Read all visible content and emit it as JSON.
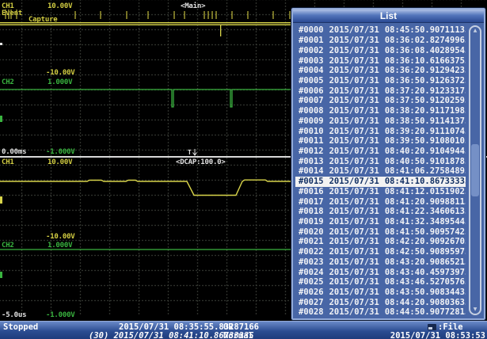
{
  "scope": {
    "overview": {
      "ch_label": "CH1",
      "ch_scale": "10.00V",
      "mode_label": "<Main>",
      "event_label": "Event",
      "capture_label": "Capture"
    },
    "upper_section": {
      "ch1_neg_scale": "-10.00V",
      "ch2_label": "CH2",
      "ch2_scale": "1.000V",
      "time_offset": "0.00ms",
      "ch2_neg_scale": "-1.000V"
    },
    "lower_section": {
      "ch1_label": "CH1",
      "ch1_scale": "10.00V",
      "dcap_label": "<DCAP:100.0>",
      "trigger_marker": "T",
      "ch1_neg_scale": "-10.00V",
      "ch2_label": "CH2",
      "ch2_scale": "1.000V",
      "time_offset": "-5.0us",
      "ch2_neg_scale": "-1.000V"
    },
    "colors": {
      "ch1_yellow": "#d2cd42",
      "ch2_green": "#39b33f",
      "white": "#e4e4e4"
    }
  },
  "list_dialog": {
    "title": "List",
    "selected_index": 15,
    "rows": [
      {
        "id": "#0000",
        "date": "2015/07/31",
        "time": "08:45:50.90711135"
      },
      {
        "id": "#0001",
        "date": "2015/07/31",
        "time": "08:36:02.82749965"
      },
      {
        "id": "#0002",
        "date": "2015/07/31",
        "time": "08:36:08.40289545"
      },
      {
        "id": "#0003",
        "date": "2015/07/31",
        "time": "08:36:10.61663755"
      },
      {
        "id": "#0004",
        "date": "2015/07/31",
        "time": "08:36:20.91294235"
      },
      {
        "id": "#0005",
        "date": "2015/07/31",
        "time": "08:36:50.91263725"
      },
      {
        "id": "#0006",
        "date": "2015/07/31",
        "time": "08:37:20.91233175"
      },
      {
        "id": "#0007",
        "date": "2015/07/31",
        "time": "08:37:50.91202595"
      },
      {
        "id": "#0008",
        "date": "2015/07/31",
        "time": "08:38:20.91171985"
      },
      {
        "id": "#0009",
        "date": "2015/07/31",
        "time": "08:38:50.91141375"
      },
      {
        "id": "#0010",
        "date": "2015/07/31",
        "time": "08:39:20.91110745"
      },
      {
        "id": "#0011",
        "date": "2015/07/31",
        "time": "08:39:50.91080105"
      },
      {
        "id": "#0012",
        "date": "2015/07/31",
        "time": "08:40:20.91049445"
      },
      {
        "id": "#0013",
        "date": "2015/07/31",
        "time": "08:40:50.91018785"
      },
      {
        "id": "#0014",
        "date": "2015/07/31",
        "time": "08:41:06.27584895"
      },
      {
        "id": "#0015",
        "date": "2015/07/31",
        "time": "08:41:10.86733335"
      },
      {
        "id": "#0016",
        "date": "2015/07/31",
        "time": "08:41:12.01519025"
      },
      {
        "id": "#0017",
        "date": "2015/07/31",
        "time": "08:41:20.90988115"
      },
      {
        "id": "#0018",
        "date": "2015/07/31",
        "time": "08:41:22.34606135"
      },
      {
        "id": "#0019",
        "date": "2015/07/31",
        "time": "08:41:32.34895445"
      },
      {
        "id": "#0020",
        "date": "2015/07/31",
        "time": "08:41:50.90957425"
      },
      {
        "id": "#0021",
        "date": "2015/07/31",
        "time": "08:42:20.90926705"
      },
      {
        "id": "#0022",
        "date": "2015/07/31",
        "time": "08:42:50.90895975"
      },
      {
        "id": "#0023",
        "date": "2015/07/31",
        "time": "08:43:20.90865215"
      },
      {
        "id": "#0024",
        "date": "2015/07/31",
        "time": "08:43:40.45973975"
      },
      {
        "id": "#0025",
        "date": "2015/07/31",
        "time": "08:43:46.52705765"
      },
      {
        "id": "#0026",
        "date": "2015/07/31",
        "time": "08:43:50.90834435"
      },
      {
        "id": "#0027",
        "date": "2015/07/31",
        "time": "08:44:20.90803635"
      },
      {
        "id": "#0028",
        "date": "2015/07/31",
        "time": "08:44:50.90772815"
      }
    ]
  },
  "status_bar": {
    "acq_state": "Stopped",
    "start_timestamp": "2015/07/31 08:35:55.83287166",
    "or_label": "OR",
    "history_info": "(30) 2015/07/31 08:41:10.86733335",
    "trigger_mode": "Normal",
    "file_label": ":File",
    "clock": "2015/07/31 08:53:53"
  }
}
